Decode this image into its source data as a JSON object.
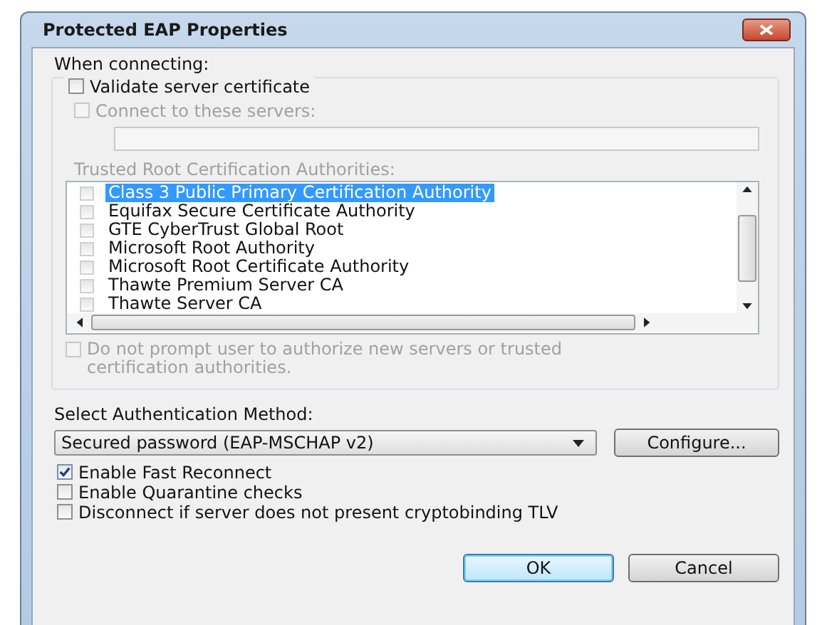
{
  "window": {
    "title": "Protected EAP Properties"
  },
  "connecting": {
    "label": "When connecting:",
    "validate": {
      "label": "Validate server certificate",
      "checked": false,
      "disabled": false
    },
    "connect_servers": {
      "label": "Connect to these servers:",
      "checked": false,
      "disabled": true
    },
    "trusted_label": "Trusted Root Certification Authorities:",
    "authorities": [
      {
        "label": "Class 3 Public Primary Certification Authority",
        "checked": false,
        "selected": true
      },
      {
        "label": "Equifax Secure Certificate Authority",
        "checked": false,
        "selected": false
      },
      {
        "label": "GTE CyberTrust Global Root",
        "checked": false,
        "selected": false
      },
      {
        "label": "Microsoft Root Authority",
        "checked": false,
        "selected": false
      },
      {
        "label": "Microsoft Root Certificate Authority",
        "checked": false,
        "selected": false
      },
      {
        "label": "Thawte Premium Server CA",
        "checked": false,
        "selected": false
      },
      {
        "label": "Thawte Server CA",
        "checked": false,
        "selected": false
      }
    ],
    "no_prompt": {
      "label": "Do not prompt user to authorize new servers or trusted certification authorities.",
      "checked": false,
      "disabled": true
    }
  },
  "auth": {
    "label": "Select Authentication Method:",
    "method": "Secured password (EAP-MSCHAP v2)",
    "configure": "Configure..."
  },
  "options": [
    {
      "label": "Enable Fast Reconnect",
      "checked": true
    },
    {
      "label": "Enable Quarantine checks",
      "checked": false
    },
    {
      "label": "Disconnect if server does not present cryptobinding TLV",
      "checked": false
    }
  ],
  "buttons": [
    {
      "label": "OK",
      "default": true
    },
    {
      "label": "Cancel",
      "default": false
    }
  ]
}
